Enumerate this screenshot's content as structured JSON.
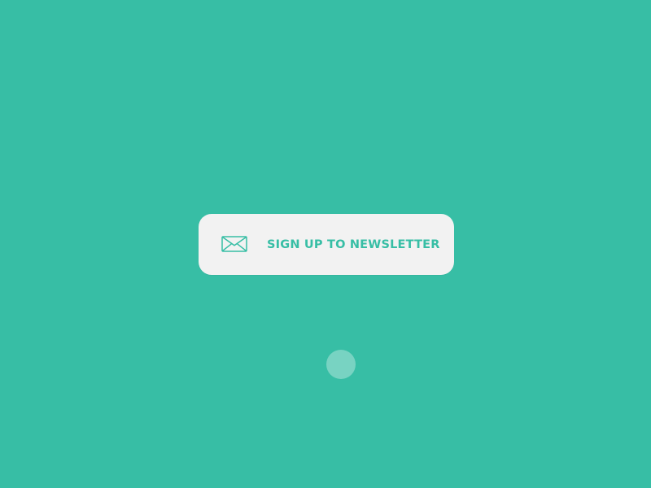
{
  "screen": {
    "background_color": "#37bea5"
  },
  "newsletter_button": {
    "label": "SIGN UP TO NEWSLETTER",
    "icon": "envelope-icon",
    "background_color": "#f2f2f2",
    "text_color": "#37bea5"
  },
  "cursor": {
    "color": "#ffffff"
  }
}
